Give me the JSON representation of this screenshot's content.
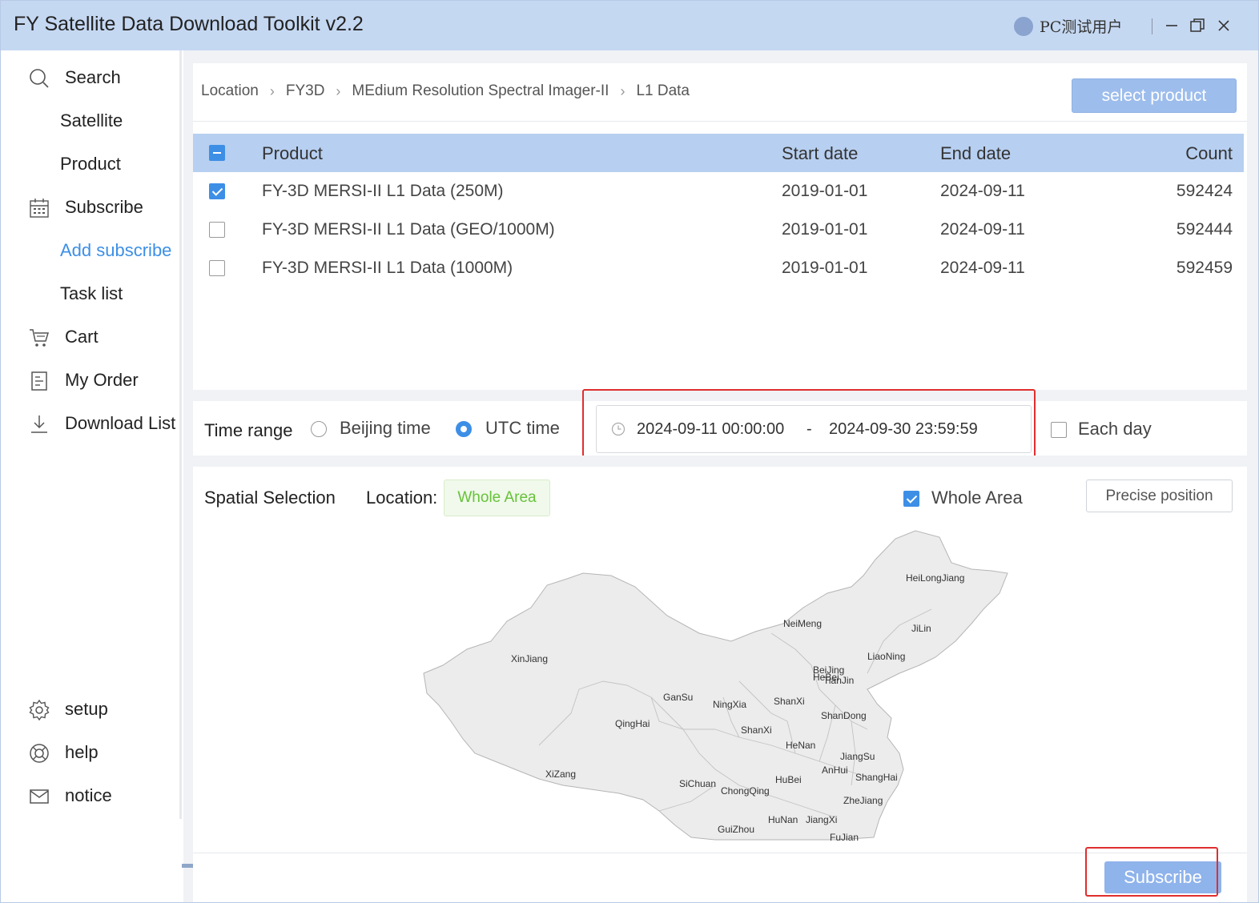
{
  "app": {
    "title": "FY Satellite Data Download Toolkit v2.2",
    "user_name": "PC测试用户"
  },
  "sidebar": {
    "items": [
      {
        "label": "Search",
        "icon": "search-icon"
      },
      {
        "label": "Satellite"
      },
      {
        "label": "Product"
      },
      {
        "label": "Subscribe",
        "icon": "calendar-icon"
      },
      {
        "label": "Add subscribe",
        "active": true
      },
      {
        "label": "Task list"
      },
      {
        "label": "Cart",
        "icon": "cart-icon"
      },
      {
        "label": "My Order",
        "icon": "document-icon"
      },
      {
        "label": "Download List",
        "icon": "download-icon"
      },
      {
        "label": "setup",
        "icon": "gear-icon"
      },
      {
        "label": "help",
        "icon": "lifebuoy-icon"
      },
      {
        "label": "notice",
        "icon": "mail-icon"
      }
    ]
  },
  "breadcrumb": [
    "Location",
    "FY3D",
    "MEdium Resolution Spectral Imager-II",
    "L1 Data"
  ],
  "select_product_label": "select product",
  "table": {
    "headers": {
      "product": "Product",
      "start": "Start date",
      "end": "End date",
      "count": "Count"
    },
    "rows": [
      {
        "product": "FY-3D MERSI-II L1 Data (250M)",
        "start": "2019-01-01",
        "end": "2024-09-11",
        "count": "592424",
        "checked": true
      },
      {
        "product": "FY-3D MERSI-II L1 Data (GEO/1000M)",
        "start": "2019-01-01",
        "end": "2024-09-11",
        "count": "592444",
        "checked": false
      },
      {
        "product": "FY-3D MERSI-II L1 Data (1000M)",
        "start": "2019-01-01",
        "end": "2024-09-11",
        "count": "592459",
        "checked": false
      }
    ]
  },
  "time_range": {
    "label": "Time range",
    "beijing_label": "Beijing time",
    "utc_label": "UTC time",
    "selected": "UTC time",
    "start": "2024-09-11 00:00:00",
    "separator": "-",
    "end": "2024-09-30 23:59:59",
    "each_day_label": "Each day",
    "each_day_checked": false
  },
  "spatial": {
    "label": "Spatial Selection",
    "location_label": "Location:",
    "location_value": "Whole Area",
    "whole_area_label": "Whole Area",
    "whole_area_checked": true,
    "precise_label": "Precise position"
  },
  "map": {
    "provinces": [
      "HeiLongJiang",
      "JiLin",
      "NeiMeng",
      "LiaoNing",
      "XinJiang",
      "BeiJing",
      "HeBei",
      "TianJin",
      "GanSu",
      "NingXia",
      "ShanXi",
      "ShanXi",
      "QingHai",
      "ShanDong",
      "HeNan",
      "JiangSu",
      "XiZang",
      "AnHui",
      "ShangHai",
      "SiChuan",
      "HuBei",
      "ChongQing",
      "ZheJiang",
      "HuNan",
      "JiangXi",
      "GuiZhou",
      "FuJian"
    ]
  },
  "subscribe_label": "Subscribe",
  "colors": {
    "titlebar": "#c5d8f2",
    "accent": "#3d8fe6",
    "table_header": "#b7cff0",
    "button": "#9dbdec",
    "highlight_outline": "#e02e2e",
    "tag_green": "#67c23a"
  }
}
